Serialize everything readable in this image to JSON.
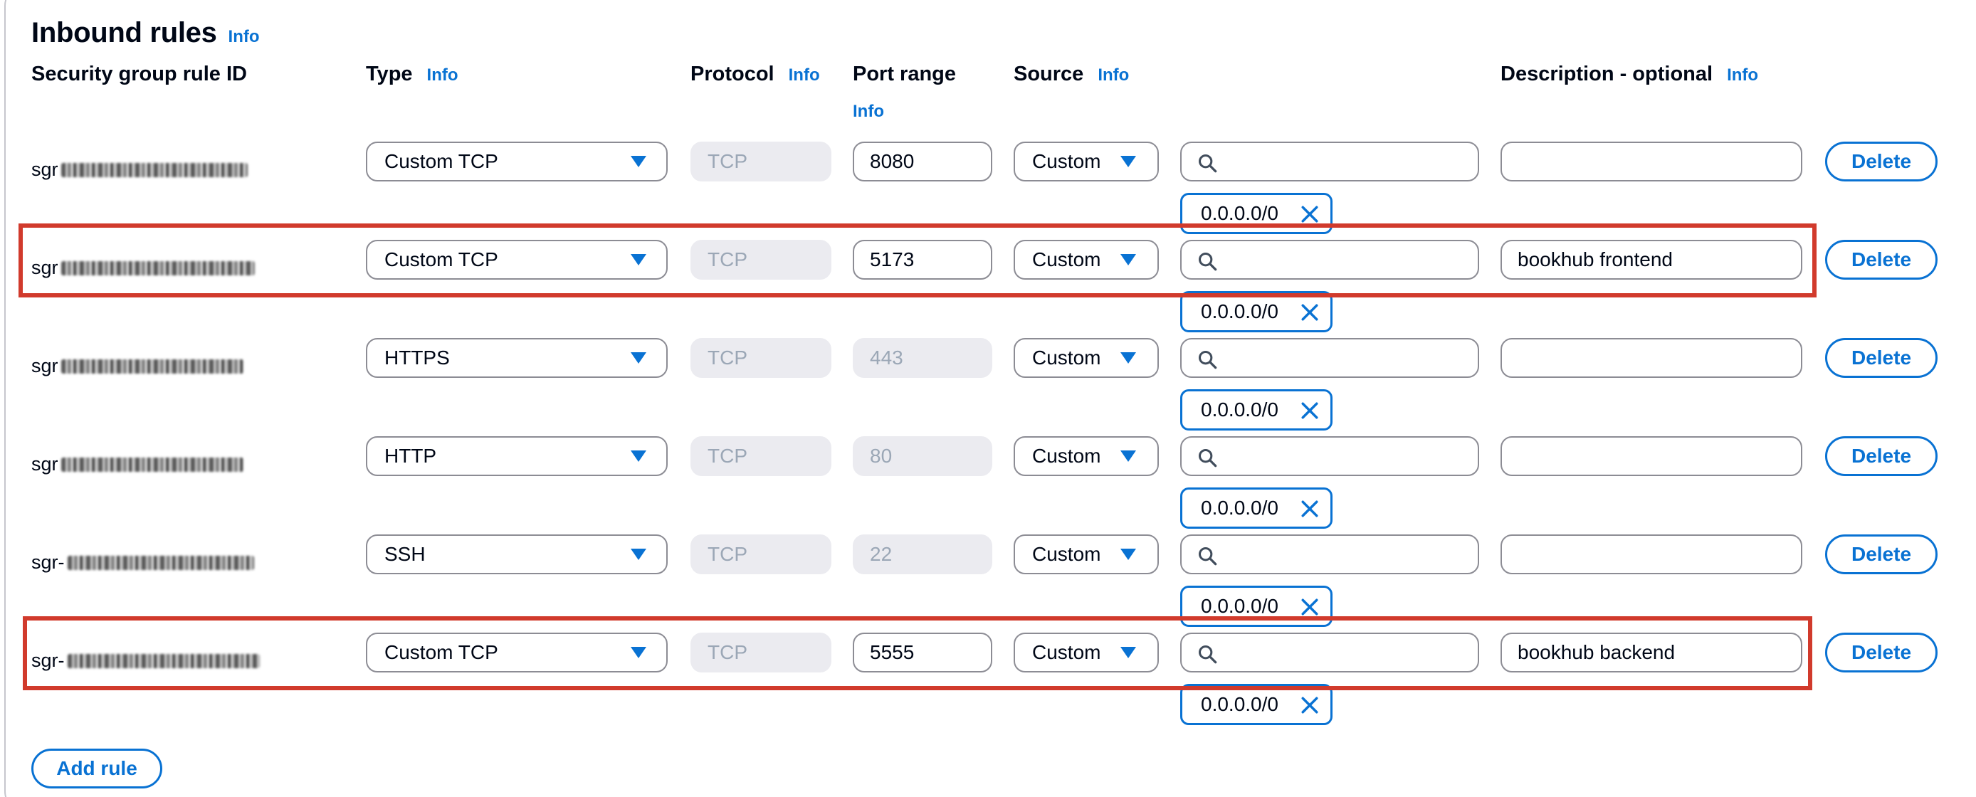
{
  "section": {
    "title": "Inbound rules",
    "info": "Info"
  },
  "columns": {
    "rule_id": "Security group rule ID",
    "type": "Type",
    "protocol": "Protocol",
    "port_range": "Port range",
    "source": "Source",
    "description": "Description - optional",
    "info": "Info"
  },
  "rules": [
    {
      "id_prefix": "sgr",
      "type": "Custom TCP",
      "protocol": "TCP",
      "port": "8080",
      "port_editable": true,
      "source": "Custom",
      "search": "",
      "cidr": "0.0.0.0/0",
      "description": ""
    },
    {
      "id_prefix": "sgr",
      "type": "Custom TCP",
      "protocol": "TCP",
      "port": "5173",
      "port_editable": true,
      "source": "Custom",
      "search": "",
      "cidr": "0.0.0.0/0",
      "description": "bookhub frontend"
    },
    {
      "id_prefix": "sgr",
      "type": "HTTPS",
      "protocol": "TCP",
      "port": "443",
      "port_editable": false,
      "source": "Custom",
      "search": "",
      "cidr": "0.0.0.0/0",
      "description": ""
    },
    {
      "id_prefix": "sgr",
      "type": "HTTP",
      "protocol": "TCP",
      "port": "80",
      "port_editable": false,
      "source": "Custom",
      "search": "",
      "cidr": "0.0.0.0/0",
      "description": ""
    },
    {
      "id_prefix": "sgr-",
      "type": "SSH",
      "protocol": "TCP",
      "port": "22",
      "port_editable": false,
      "source": "Custom",
      "search": "",
      "cidr": "0.0.0.0/0",
      "description": ""
    },
    {
      "id_prefix": "sgr-",
      "type": "Custom TCP",
      "protocol": "TCP",
      "port": "5555",
      "port_editable": true,
      "source": "Custom",
      "search": "",
      "cidr": "0.0.0.0/0",
      "description": "bookhub backend"
    }
  ],
  "buttons": {
    "delete": "Delete",
    "add_rule": "Add rule"
  },
  "icons": {
    "dropdown": "caret-down-icon",
    "search": "search-icon",
    "remove": "close-icon"
  },
  "colors": {
    "accent": "#0972d3",
    "highlight": "#d13a2c",
    "border": "#8c8c94",
    "disabled_bg": "#ebebf0"
  }
}
